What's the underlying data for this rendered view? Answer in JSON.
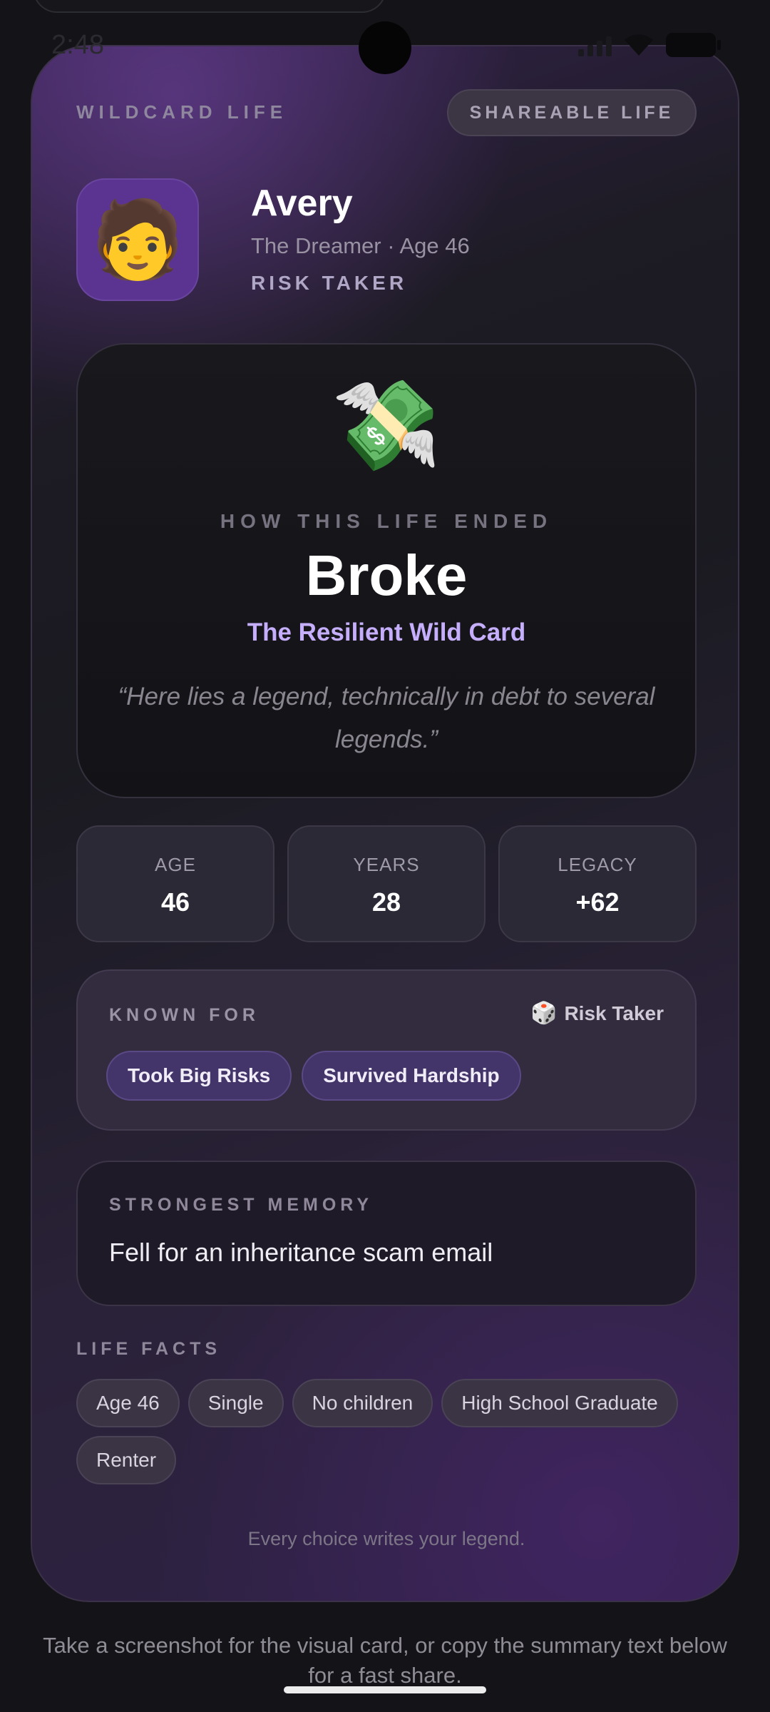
{
  "status": {
    "time": "2:48"
  },
  "card": {
    "brand": "WILDCARD LIFE",
    "badge": "SHAREABLE LIFE",
    "avatar_emoji": "🧑",
    "name": "Avery",
    "subtitle": "The Dreamer · Age 46",
    "type": "RISK TAKER",
    "ending": {
      "emoji": "💸",
      "kicker": "HOW THIS LIFE ENDED",
      "title": "Broke",
      "archetype": "The Resilient Wild Card",
      "quote": "“Here lies a legend, technically in debt to several legends.”"
    },
    "stats": [
      {
        "label": "AGE",
        "value": "46"
      },
      {
        "label": "YEARS",
        "value": "28"
      },
      {
        "label": "LEGACY",
        "value": "+62"
      }
    ],
    "known_for": {
      "label": "KNOWN FOR",
      "trait_icon": "🎲",
      "trait": "Risk Taker",
      "tags": [
        "Took Big Risks",
        "Survived Hardship"
      ]
    },
    "memory": {
      "label": "STRONGEST MEMORY",
      "text": "Fell for an inheritance scam email"
    },
    "facts": {
      "label": "LIFE FACTS",
      "items": [
        "Age 46",
        "Single",
        "No children",
        "High School Graduate",
        "Renter"
      ]
    },
    "tagline": "Every choice writes your legend."
  },
  "footer": {
    "text": "Take a screenshot for the visual card, or copy the summary text below for a fast share."
  },
  "colors": {
    "accent": "#c5aefb",
    "tag_bg": "#43346a",
    "avatar_bg": "#5a3490"
  }
}
